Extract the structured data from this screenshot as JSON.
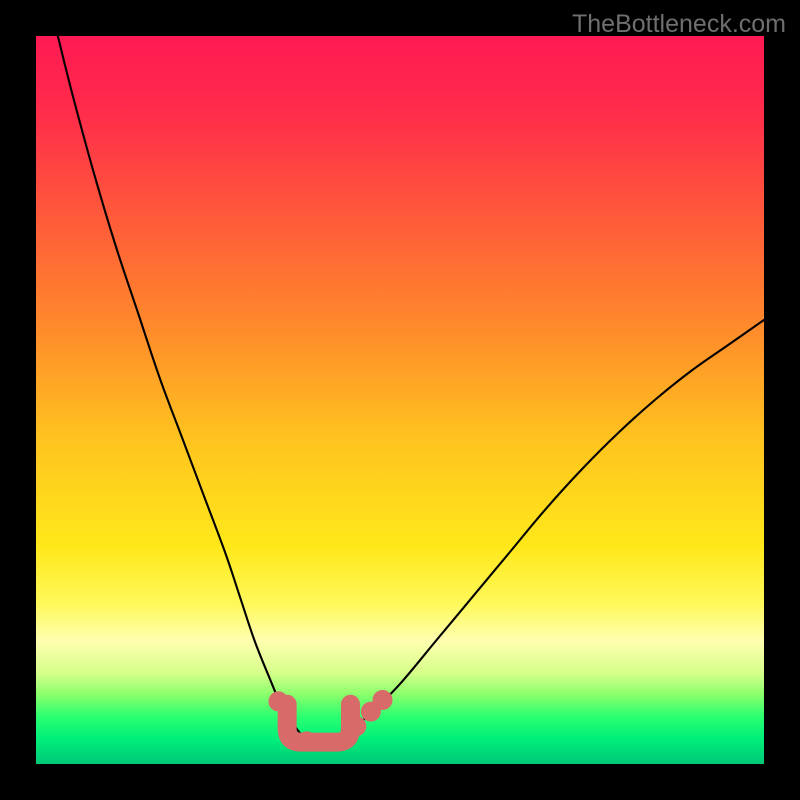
{
  "watermark": "TheBottleneck.com",
  "colors": {
    "background": "#000000",
    "gradient_stops": [
      {
        "offset": 0.0,
        "color": "#ff1a53"
      },
      {
        "offset": 0.1,
        "color": "#ff2b4b"
      },
      {
        "offset": 0.25,
        "color": "#ff5a3a"
      },
      {
        "offset": 0.4,
        "color": "#ff8a2b"
      },
      {
        "offset": 0.55,
        "color": "#ffc21f"
      },
      {
        "offset": 0.7,
        "color": "#ffe81a"
      },
      {
        "offset": 0.78,
        "color": "#fff85a"
      },
      {
        "offset": 0.83,
        "color": "#ffffb0"
      },
      {
        "offset": 0.875,
        "color": "#d6ff8a"
      },
      {
        "offset": 0.905,
        "color": "#89ff6b"
      },
      {
        "offset": 0.935,
        "color": "#2bff70"
      },
      {
        "offset": 0.965,
        "color": "#00f07a"
      },
      {
        "offset": 1.0,
        "color": "#00c877"
      }
    ],
    "curve": "#000000",
    "marker_fill": "#d86a6a",
    "marker_stroke": "#d86a6a",
    "bracket": "#d86a6a"
  },
  "chart_data": {
    "type": "line",
    "title": "",
    "xlabel": "",
    "ylabel": "",
    "xlim": [
      0,
      100
    ],
    "ylim": [
      0,
      100
    ],
    "grid": false,
    "legend": false,
    "series": [
      {
        "name": "bottleneck-curve",
        "x": [
          3,
          5,
          8,
          11,
          14,
          17,
          20,
          23,
          26,
          28,
          30,
          32,
          33.5,
          35,
          36.5,
          38,
          40,
          43,
          46,
          50,
          55,
          60,
          65,
          70,
          75,
          80,
          85,
          90,
          95,
          100
        ],
        "y": [
          100,
          92,
          81,
          71,
          62,
          53,
          45,
          37,
          29,
          23,
          17,
          12,
          8.5,
          6,
          4,
          3,
          3,
          4.5,
          7,
          11,
          17,
          23,
          29,
          35,
          40.5,
          45.5,
          50,
          54,
          57.5,
          61
        ]
      }
    ],
    "markers": {
      "name": "highlight-points",
      "x": [
        33.3,
        37.2,
        44.0,
        46.0,
        47.6
      ],
      "y": [
        8.6,
        3.1,
        5.2,
        7.2,
        8.8
      ]
    },
    "bracket": {
      "x_start": 34.5,
      "x_end": 43.2,
      "y": 3.0,
      "corner_radius_pct": 1.9,
      "vertical_rise_pct": 5.2
    }
  }
}
